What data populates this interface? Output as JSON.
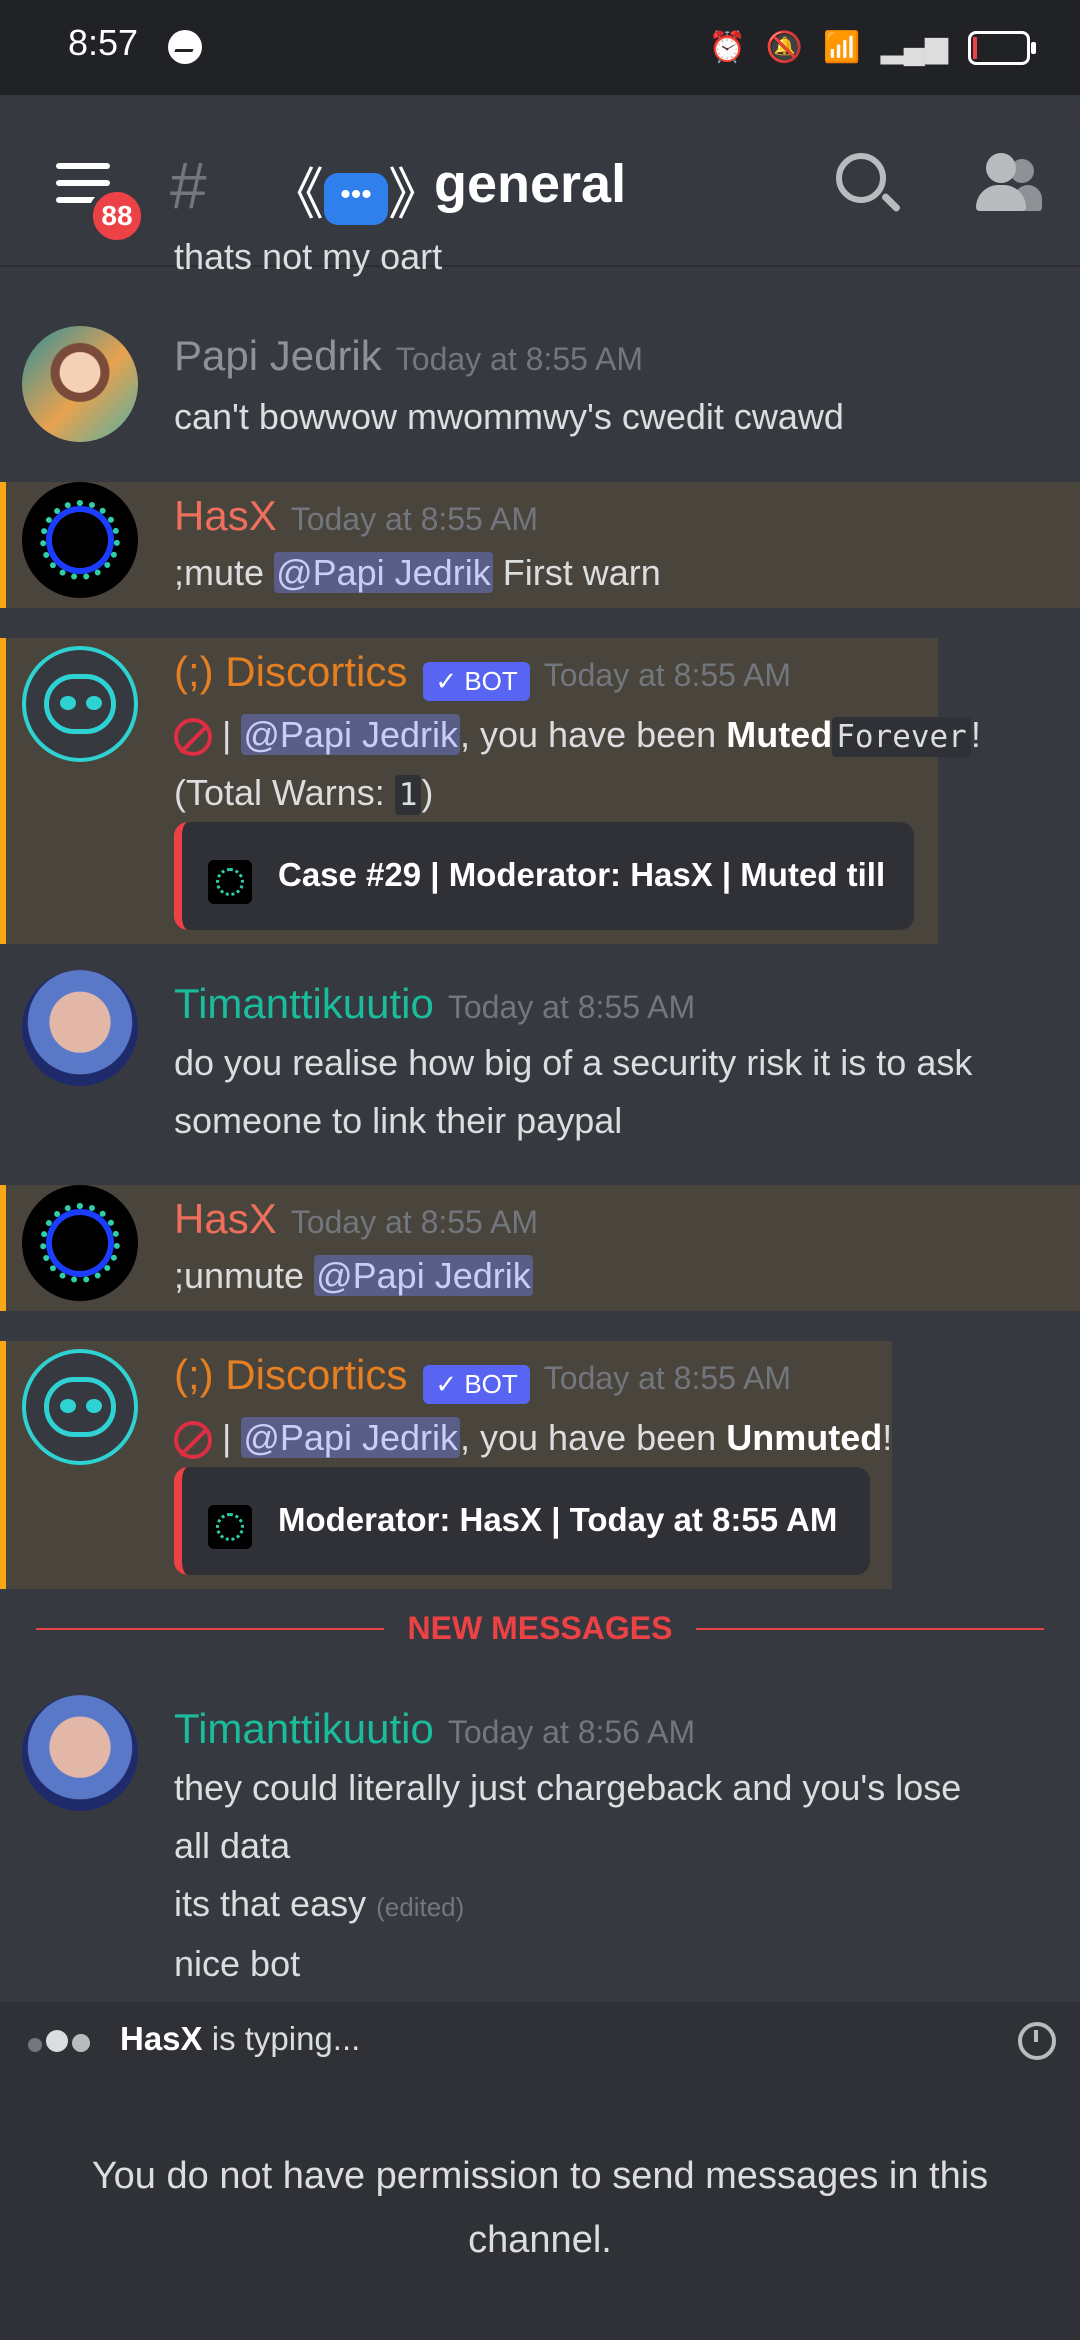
{
  "status_bar": {
    "time": "8:57"
  },
  "header": {
    "unread_badge": "88",
    "channel_emoji": "《💬》",
    "channel_name": "general"
  },
  "clipped_text": "thats not my oart",
  "messages": [
    {
      "author": "Papi Jedrik",
      "author_color": "#8e9297",
      "timestamp": "Today at 8:55 AM",
      "text": "can't bowwow mwommwy's cwedit cwawd"
    },
    {
      "author": "HasX",
      "author_color": "#ed6f5c",
      "timestamp": "Today at 8:55 AM",
      "cmd": ";mute",
      "mention": "@Papi Jedrik",
      "text": "First warn"
    },
    {
      "author": "(;) Discortics",
      "author_color": "#e67e22",
      "bot_tag": "BOT",
      "timestamp": "Today at 8:55 AM",
      "mention": "@Papi Jedrik",
      "text_a": ", you have been",
      "muted": "Muted",
      "code": "Forever",
      "bang": "!",
      "line2_a": "(Total Warns:",
      "line2_code": "1",
      "line2_b": ")",
      "embed": "Case #29 | Moderator: HasX | Muted till"
    },
    {
      "author": "Timanttikuutio",
      "author_color": "#1abc9c",
      "timestamp": "Today at 8:55 AM",
      "line1": "do you realise how big of a security risk it is to ask",
      "line2": "someone to link their paypal"
    },
    {
      "author": "HasX",
      "author_color": "#ed6f5c",
      "timestamp": "Today at 8:55 AM",
      "cmd": ";unmute",
      "mention": "@Papi Jedrik"
    },
    {
      "author": "(;) Discortics",
      "author_color": "#e67e22",
      "bot_tag": "BOT",
      "timestamp": "Today at 8:55 AM",
      "mention": "@Papi Jedrik",
      "text_a": ", you have been",
      "unmuted": "Unmuted",
      "bang": "!",
      "embed": "Moderator: HasX | Today at 8:55 AM"
    },
    {
      "author": "Timanttikuutio",
      "author_color": "#1abc9c",
      "timestamp": "Today at 8:56 AM",
      "line1": "they could literally just chargeback and you's lose",
      "line2": "all data",
      "line3": "its that easy",
      "edited": "(edited)",
      "line4": "nice bot"
    }
  ],
  "divider": "NEW MESSAGES",
  "typing": {
    "user": "HasX",
    "suffix": " is typing..."
  },
  "footer": {
    "line1": "You do not have permission to send messages in this",
    "line2": "channel."
  }
}
